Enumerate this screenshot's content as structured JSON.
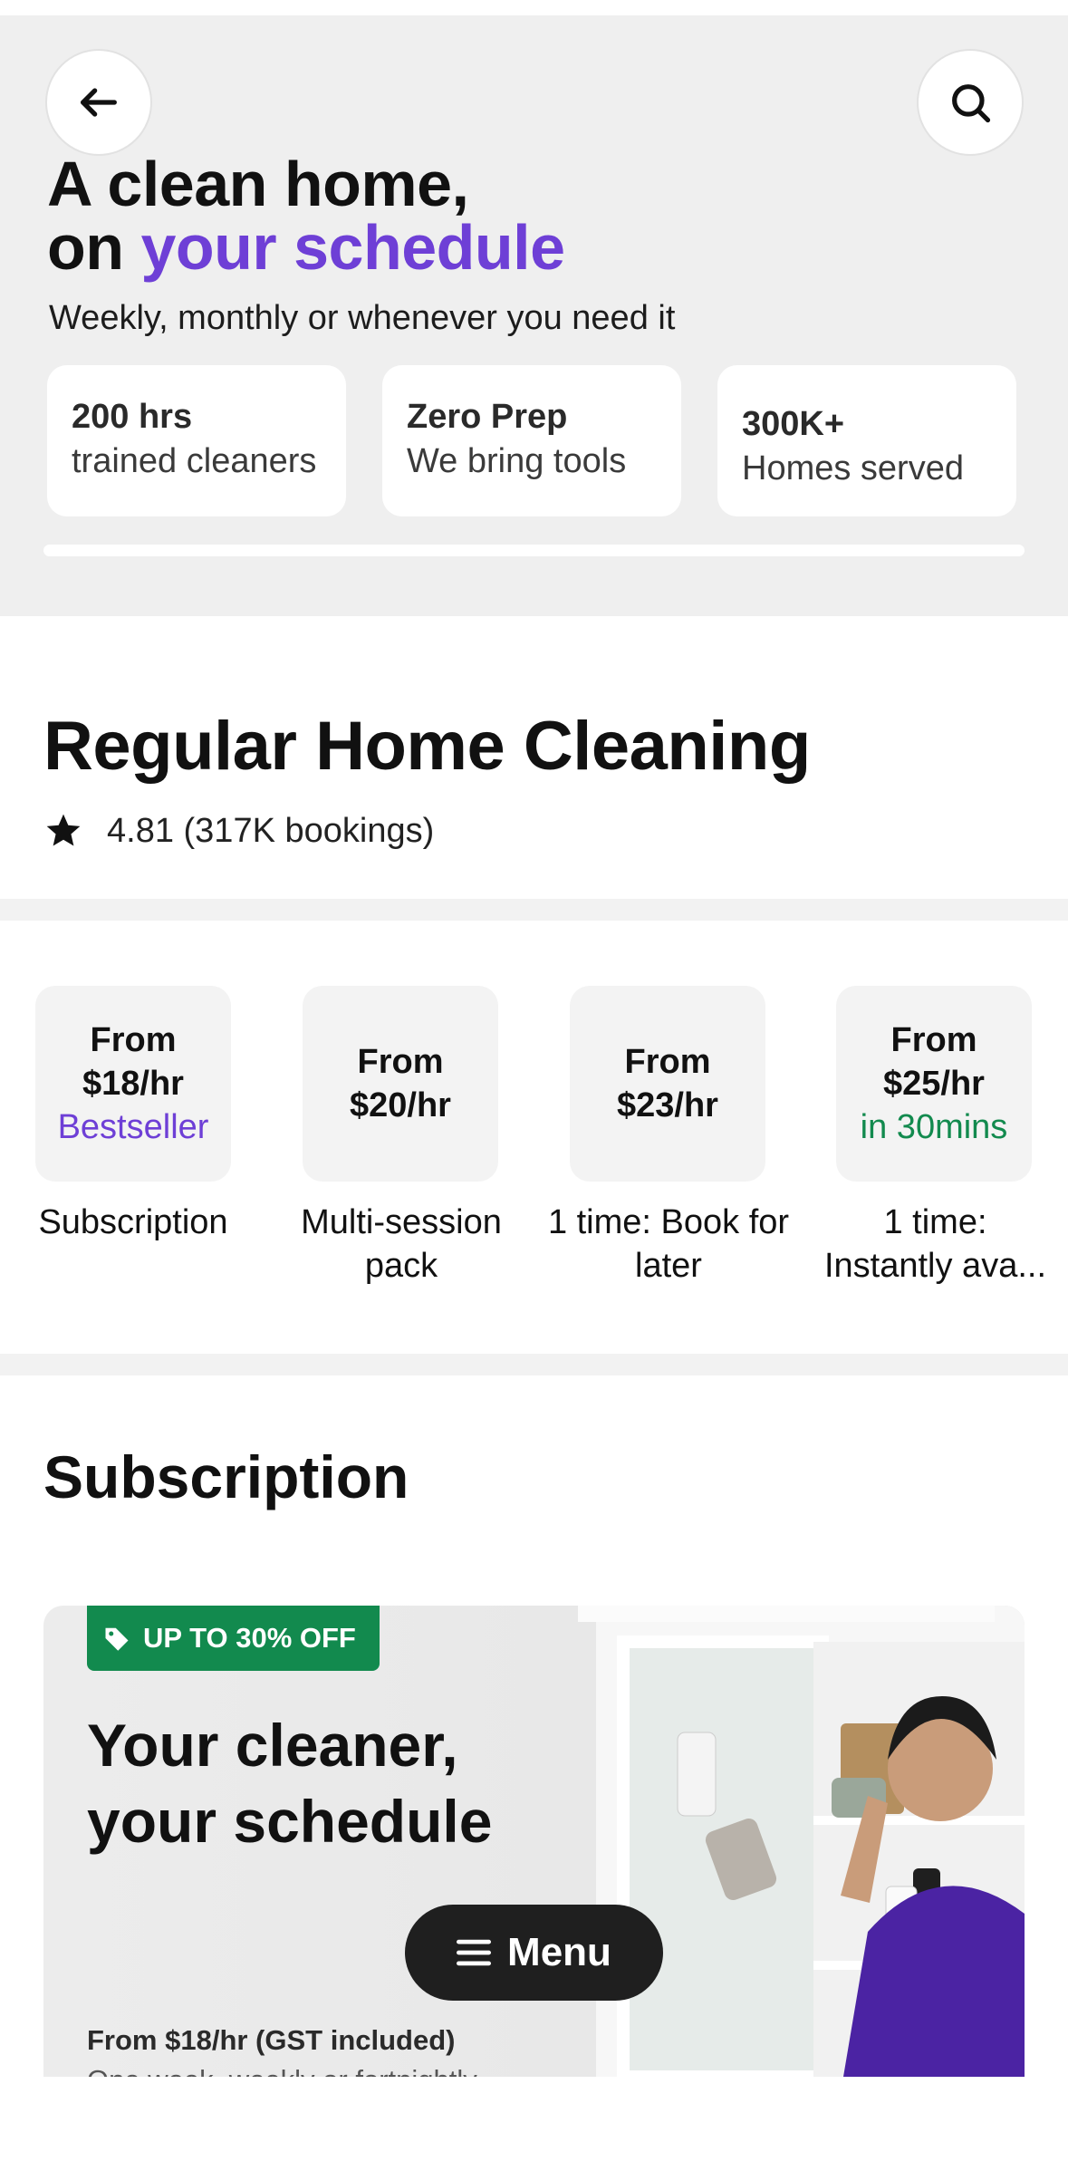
{
  "hero": {
    "title_line1": "A clean home,",
    "title_line2_prefix": "on ",
    "title_line2_accent": "your schedule",
    "subtitle": "Weekly, monthly or whenever you need it",
    "stats": [
      {
        "big": "200 hrs",
        "small": "trained cleaners"
      },
      {
        "big": "Zero Prep",
        "small": "We bring tools"
      },
      {
        "big": "300K+",
        "small": "Homes served"
      }
    ]
  },
  "service": {
    "title": "Regular Home Cleaning",
    "rating": "4.81 (317K bookings)"
  },
  "options": [
    {
      "line1": "From",
      "line2": "$18/hr",
      "tag": "Bestseller",
      "label": "Subscription"
    },
    {
      "line1": "From",
      "line2": "$20/hr",
      "tag": "",
      "label": "Multi-session pack"
    },
    {
      "line1": "From",
      "line2": "$23/hr",
      "tag": "",
      "label": "1 time: Book for later"
    },
    {
      "line1": "From",
      "line2": "$25/hr",
      "tag": "in 30mins",
      "label": "1 time: Instantly ava..."
    }
  ],
  "subscription": {
    "title": "Subscription",
    "badge": "UP TO 30% OFF",
    "banner_title_line1": "Your cleaner,",
    "banner_title_line2": "your schedule",
    "price": "From $18/hr (GST included)",
    "cut_text": "One week, weekly or fortnightly"
  },
  "menu": {
    "label": "Menu"
  },
  "icons": {
    "back": "back-arrow-icon",
    "search": "search-icon",
    "star": "star-icon",
    "tag": "tag-icon",
    "menu": "menu-icon"
  },
  "colors": {
    "accent": "#6e3fd6",
    "green": "#128a4e",
    "fab": "#1f1f1f"
  }
}
